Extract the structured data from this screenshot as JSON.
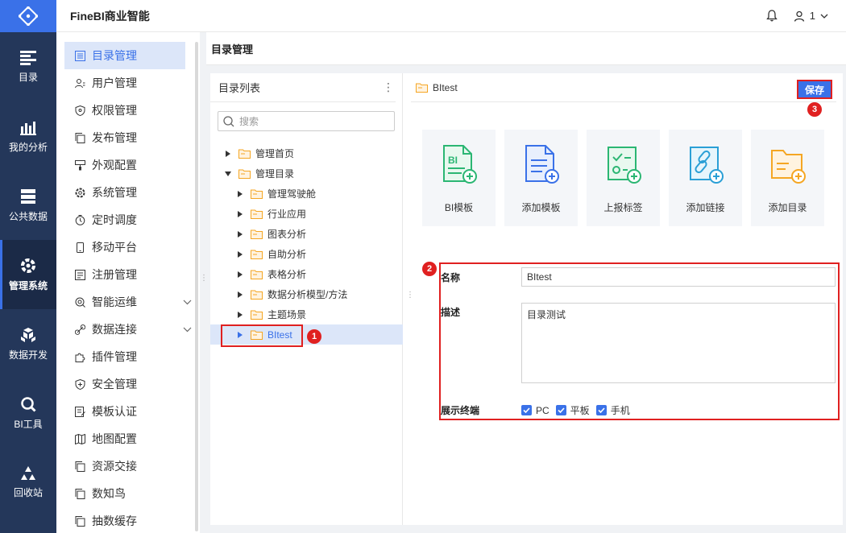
{
  "header": {
    "app_title": "FineBI商业智能",
    "user_name": "1"
  },
  "leftnav": {
    "items": [
      {
        "label": "目录"
      },
      {
        "label": "我的分析"
      },
      {
        "label": "公共数据"
      },
      {
        "label": "管理系统"
      },
      {
        "label": "数据开发"
      },
      {
        "label": "BI工具"
      },
      {
        "label": "回收站"
      }
    ],
    "active": "管理系统"
  },
  "submenu": {
    "items": [
      {
        "label": "目录管理",
        "icon": "list-icon"
      },
      {
        "label": "用户管理",
        "icon": "user-icon"
      },
      {
        "label": "权限管理",
        "icon": "shield-icon"
      },
      {
        "label": "发布管理",
        "icon": "copy-icon"
      },
      {
        "label": "外观配置",
        "icon": "brush-icon"
      },
      {
        "label": "系统管理",
        "icon": "gear-icon"
      },
      {
        "label": "定时调度",
        "icon": "clock-icon"
      },
      {
        "label": "移动平台",
        "icon": "phone-icon"
      },
      {
        "label": "注册管理",
        "icon": "register-icon"
      },
      {
        "label": "智能运维",
        "icon": "ops-icon"
      },
      {
        "label": "数据连接",
        "icon": "link-icon"
      },
      {
        "label": "插件管理",
        "icon": "puzzle-icon"
      },
      {
        "label": "安全管理",
        "icon": "security-icon"
      },
      {
        "label": "模板认证",
        "icon": "cert-icon"
      },
      {
        "label": "地图配置",
        "icon": "map-icon"
      },
      {
        "label": "资源交接",
        "icon": "copy-icon"
      },
      {
        "label": "数知鸟",
        "icon": "copy-icon"
      },
      {
        "label": "抽数缓存",
        "icon": "copy-icon"
      }
    ]
  },
  "content": {
    "title": "目录管理"
  },
  "tree_panel": {
    "title": "目录列表",
    "search_placeholder": "搜索",
    "nodes": [
      {
        "label": "管理首页"
      },
      {
        "label": "管理目录"
      },
      {
        "label": "管理驾驶舱"
      },
      {
        "label": "行业应用"
      },
      {
        "label": "图表分析"
      },
      {
        "label": "自助分析"
      },
      {
        "label": "表格分析"
      },
      {
        "label": "数据分析模型/方法"
      },
      {
        "label": "主题场景"
      },
      {
        "label": "BItest"
      }
    ]
  },
  "detail": {
    "folder_name": "BItest",
    "save_label": "保存",
    "cards": [
      {
        "label": "BI模板"
      },
      {
        "label": "添加模板"
      },
      {
        "label": "上报标签"
      },
      {
        "label": "添加链接"
      },
      {
        "label": "添加目录"
      }
    ],
    "form": {
      "name_label": "名称",
      "name_value": "BItest",
      "desc_label": "描述",
      "desc_value": "目录测试",
      "terminal_label": "展示终端",
      "terminals": [
        "PC",
        "平板",
        "手机"
      ]
    }
  },
  "annotations": [
    "1",
    "2",
    "3"
  ],
  "colors": {
    "primary": "#3a71e8",
    "nav_bg": "#24375a",
    "highlight_red": "#e02020",
    "folder_orange": "#f5a623",
    "card_green": "#2bb673",
    "card_blue": "#3a71e8",
    "card_cyan": "#2a9fd6"
  }
}
